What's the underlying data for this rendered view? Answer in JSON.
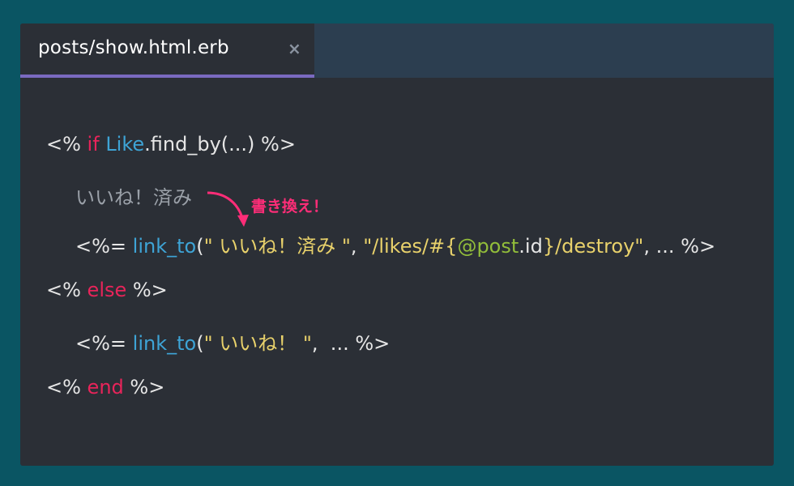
{
  "tab": {
    "title": "posts/show.html.erb",
    "close": "×"
  },
  "code": {
    "line1": {
      "open": "<% ",
      "kw": "if",
      "cls": "Like",
      "rest": ".find_by(...) %>"
    },
    "comment": {
      "text": "いいね！済み"
    },
    "line2": {
      "open": "<%= ",
      "fn": "link_to",
      "paren": "(",
      "str1": "\" いいね！済み \"",
      "sep1": ", ",
      "str2a": "\"/likes/#{",
      "ivar": "@post",
      "str2b": ".id",
      "str2c": "}/destroy\"",
      "rest": ", ... %>"
    },
    "line3": {
      "open": "<% ",
      "kw": "else",
      "rest": " %>"
    },
    "line4": {
      "open": "<%= ",
      "fn": "link_to",
      "paren": "(",
      "str": "\" いいね！ \"",
      "rest": ",  ... %>"
    },
    "line5": {
      "open": "<% ",
      "kw": "end",
      "rest": " %>"
    }
  },
  "annotation": {
    "label": "書き換え！",
    "color": "#ff2d78"
  },
  "colors": {
    "background": "#0a5563",
    "editor": "#2b2f36",
    "tab_underline": "#7a6ac0",
    "keyword": "#e8245a",
    "function": "#3ea4d6",
    "string": "#e8d16b",
    "instance_var": "#92bd3a"
  }
}
